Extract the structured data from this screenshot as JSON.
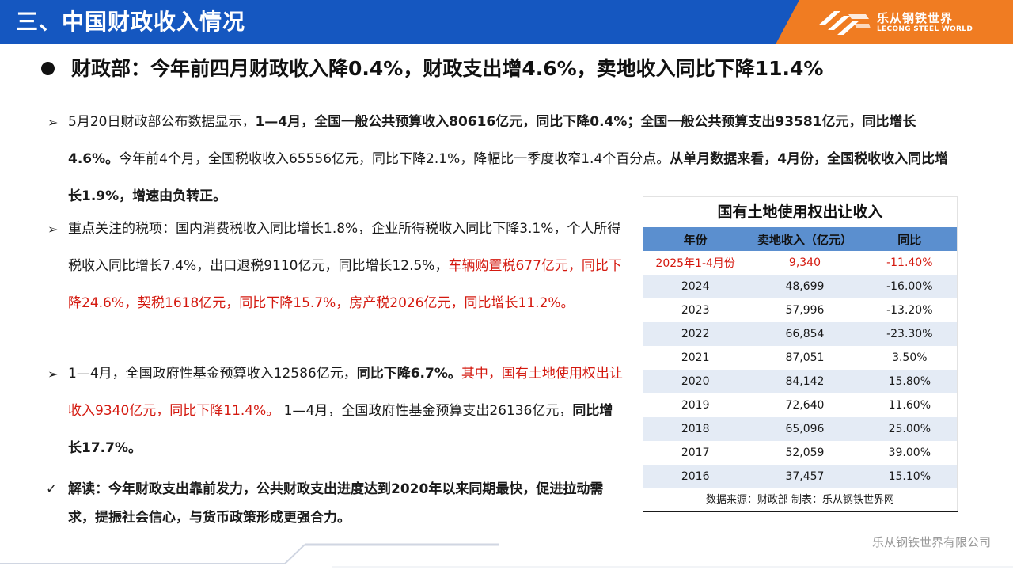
{
  "header": {
    "title": "三、中国财政收入情况",
    "logo_cn": "乐从钢铁世界",
    "logo_en": "LECONG STEEL WORLD"
  },
  "headline": "财政部：今年前四月财政收入降0.4%，财政支出增4.6%，卖地收入同比下降11.4%",
  "p1": {
    "s1": "5月20日财政部公布数据显示，",
    "s2": "1—4月，全国一般公共预算收入80616亿元，同比下降0.4%；全国一般公共预算支出93581亿元，同比增长4.6%。",
    "s3": "今年前4个月，全国税收收入65556亿元，同比下降2.1%，降幅比一季度收窄1.4个百分点。",
    "s4": "从单月数据来看，4月份，全国税收收入同比增长1.9%，增速由负转正。"
  },
  "p2": {
    "s1": "重点关注的税项：国内消费税收入同比增长1.8%，企业所得税收入同比下降3.1%，个人所得税收入同比增长7.4%，出口退税9110亿元，同比增长12.5%，",
    "s2": "车辆购置税677亿元，同比下降24.6%，契税1618亿元，同比下降15.7%，房产税2026亿元，同比增长11.2%。"
  },
  "p3": {
    "s1": "1—4月，全国政府性基金预算收入12586亿元，",
    "s2": "同比下降6.7%。",
    "s3": "其中，国有土地使用权出让收入9340亿元，同比下降11.4%。",
    "s4": " 1—4月，全国政府性基金预算支出26136亿元，",
    "s5": "同比增长17.7%。"
  },
  "conclusion": "解读：今年财政支出靠前发力，公共财政支出进度达到2020年以来同期最快，促进拉动需求，提振社会信心，与货币政策形成更强合力。",
  "table": {
    "title": "国有土地使用权出让收入",
    "headers": [
      "年份",
      "卖地收入（亿元）",
      "同比"
    ],
    "rows": [
      [
        "2025年1-4月份",
        "9,340",
        "-11.40%"
      ],
      [
        "2024",
        "48,699",
        "-16.00%"
      ],
      [
        "2023",
        "57,996",
        "-13.20%"
      ],
      [
        "2022",
        "66,854",
        "-23.30%"
      ],
      [
        "2021",
        "87,051",
        "3.50%"
      ],
      [
        "2020",
        "84,142",
        "15.80%"
      ],
      [
        "2019",
        "72,640",
        "11.60%"
      ],
      [
        "2018",
        "65,096",
        "25.00%"
      ],
      [
        "2017",
        "52,059",
        "39.00%"
      ],
      [
        "2016",
        "37,457",
        "15.10%"
      ]
    ],
    "source": "数据来源：财政部   制表：乐从钢铁世界网"
  },
  "footer": {
    "company": "乐从钢铁世界有限公司"
  },
  "colors": {
    "header_blue": "#1557c0",
    "logo_orange": "#f07c22",
    "highlight_red": "#d4190f",
    "table_header": "#5b8fcf"
  }
}
